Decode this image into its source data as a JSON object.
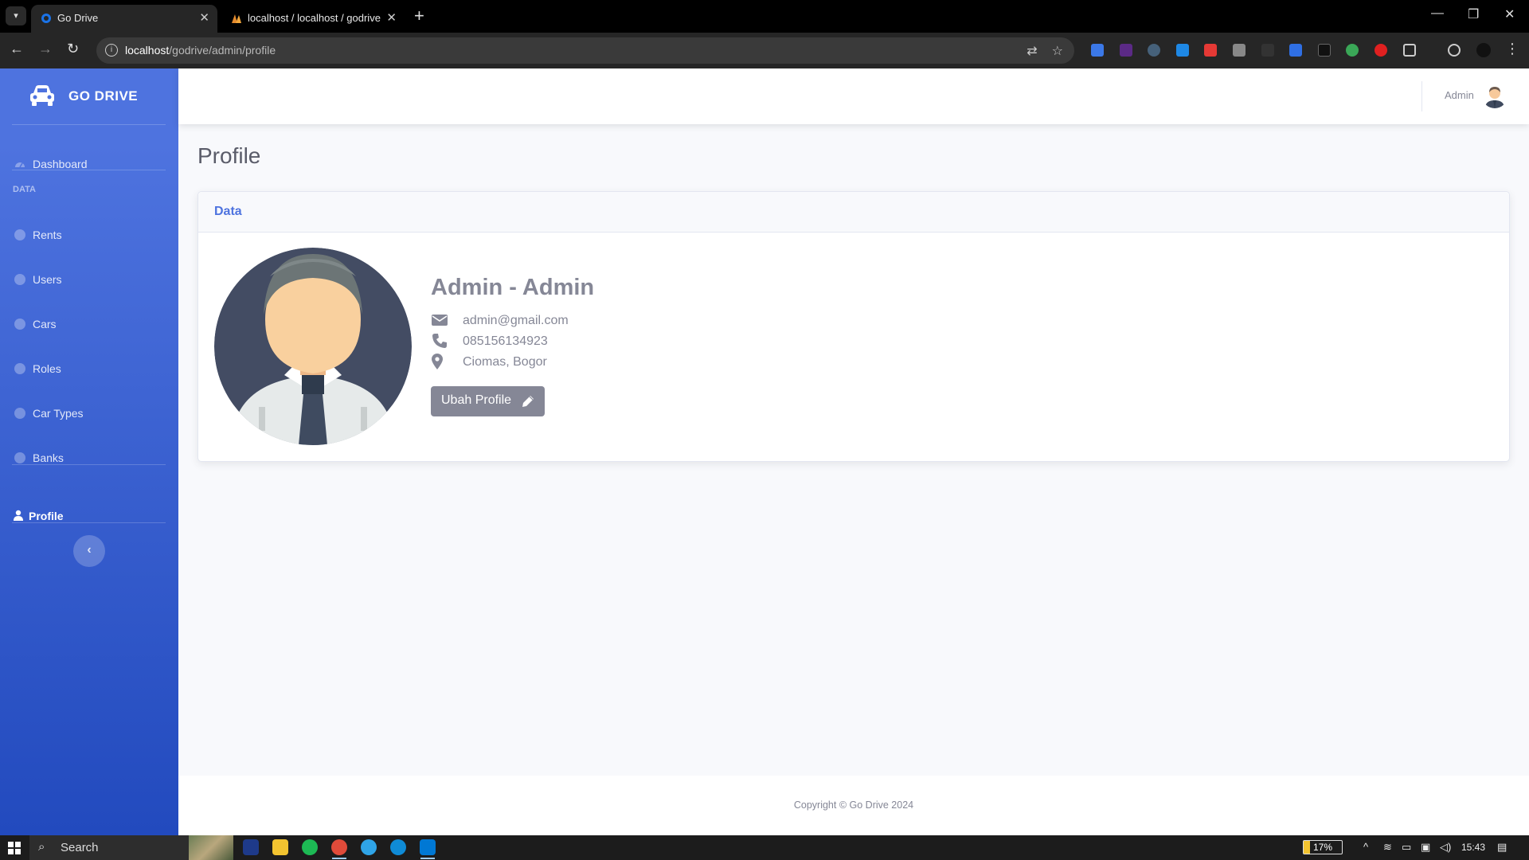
{
  "browser": {
    "tabs": [
      {
        "title": "Go Drive",
        "active": true
      },
      {
        "title": "localhost / localhost / godrive /",
        "active": false
      }
    ],
    "url_host": "localhost",
    "url_path": "/godrive/admin/profile"
  },
  "sidebar": {
    "brand": "GO DRIVE",
    "dashboard_label": "Dashboard",
    "heading": "DATA",
    "items": [
      {
        "label": "Rents"
      },
      {
        "label": "Users"
      },
      {
        "label": "Cars"
      },
      {
        "label": "Roles"
      },
      {
        "label": "Car Types"
      },
      {
        "label": "Banks"
      }
    ],
    "profile_label": "Profile",
    "toggle_icon": "chevron-left-icon"
  },
  "topbar": {
    "user_name": "Admin"
  },
  "page": {
    "title": "Profile",
    "card_header": "Data",
    "full_name": "Admin - Admin",
    "email": "admin@gmail.com",
    "phone": "085156134923",
    "address": "Ciomas, Bogor",
    "edit_button": "Ubah Profile"
  },
  "footer": {
    "copyright": "Copyright © Go Drive 2024"
  },
  "taskbar": {
    "search_label": "Search",
    "battery": "17%",
    "time": "15:43"
  },
  "colors": {
    "primary": "#4e73df",
    "sidebar_dark": "#224abe",
    "text_gray": "#858796"
  }
}
